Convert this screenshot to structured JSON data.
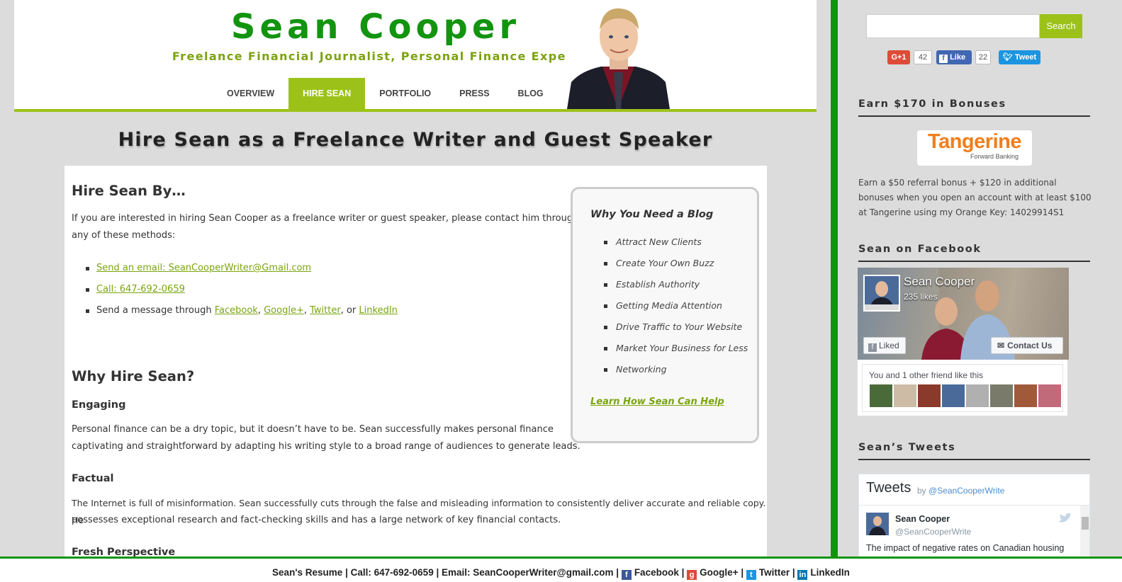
{
  "header": {
    "site_title": "Sean Cooper",
    "tagline": "Freelance Financial Journalist, Personal Finance Expert",
    "nav": [
      "OVERVIEW",
      "HIRE SEAN",
      "PORTFOLIO",
      "PRESS",
      "BLOG"
    ],
    "active_nav": "HIRE SEAN"
  },
  "page": {
    "title": "Hire Sean as a Freelance Writer and Guest Speaker"
  },
  "content": {
    "hire_by_heading": "Hire Sean By…",
    "hire_by_intro_1": "If you are interested in hiring Sean Cooper as a freelance writer or guest speaker, please contact him through",
    "hire_by_intro_2": "any of these methods:",
    "email_link": "Send an email: SeanCooperWriter@Gmail.com",
    "call_link": "Call: 647-692-0659",
    "message_prefix": "Send a message through",
    "facebook_link": "Facebook",
    "googleplus_link": "Google+",
    "twitter_link": "Twitter",
    "or_word": "or",
    "linkedin_link": "LinkedIn",
    "why_heading": "Why Hire Sean?",
    "engaging_heading": "Engaging",
    "engaging_1": "Personal finance can be a dry topic, but it doesn’t have to be. Sean successfully makes personal finance",
    "engaging_2": "captivating and straightforward by adapting his writing style to a broad range of audiences to generate leads.",
    "factual_heading": "Factual",
    "factual_1": "The Internet is full of misinformation. Sean successfully cuts through the false and misleading information to consistently deliver accurate and reliable copy. He",
    "factual_2": "possesses exceptional research and fact-checking skills and has a large network of key financial contacts.",
    "fresh_heading": "Fresh Perspective"
  },
  "blog_box": {
    "title": "Why You Need a Blog",
    "items": [
      "Attract New Clients",
      "Create Your Own Buzz",
      "Establish Authority",
      "Getting Media Attention",
      "Drive Traffic to Your Website",
      "Market Your Business for Less",
      "Networking"
    ],
    "link": "Learn How Sean Can Help"
  },
  "sidebar": {
    "search_button": "Search",
    "search_placeholder": "",
    "gplus_label": "G+1",
    "gplus_count": "42",
    "fb_like_label": "Like",
    "fb_like_count": "22",
    "tweet_label": "Tweet",
    "bonus_title": "Earn $170 in Bonuses",
    "tangerine_name": "Tangerine",
    "tangerine_sub": "Forward Banking",
    "tangerine_text": "Earn a $50 referral bonus + $120 in additional bonuses when you open an account with at least $100 at Tangerine using my Orange Key: 14029914S1",
    "facebook_title": "Sean on Facebook",
    "fb_page_name": "Sean Cooper",
    "fb_likes": "235 likes",
    "fb_liked": "Liked",
    "fb_contact": "Contact Us",
    "fb_friends_text": "You and 1 other friend like this",
    "tweets_title": "Sean’s Tweets",
    "tw_heading": "Tweets",
    "tw_by": "by",
    "tw_by_handle": "@SeanCooperWrite",
    "tw_name": "Sean Cooper",
    "tw_handle": "@SeanCooperWrite",
    "tw_text": "The impact of negative rates on Canadian housing"
  },
  "footer": {
    "resume": "Sean's Resume",
    "call": "Call: 647-692-0659",
    "email": "Email: SeanCooperWriter@gmail.com",
    "facebook": "Facebook",
    "googleplus": "Google+",
    "twitter": "Twitter",
    "linkedin": "LinkedIn",
    "separator": "|"
  },
  "colors": {
    "brand_green": "#12940f",
    "accent_lime": "#9cc21a",
    "link_green": "#7aa50f",
    "tangerine_orange": "#f07e1c"
  }
}
